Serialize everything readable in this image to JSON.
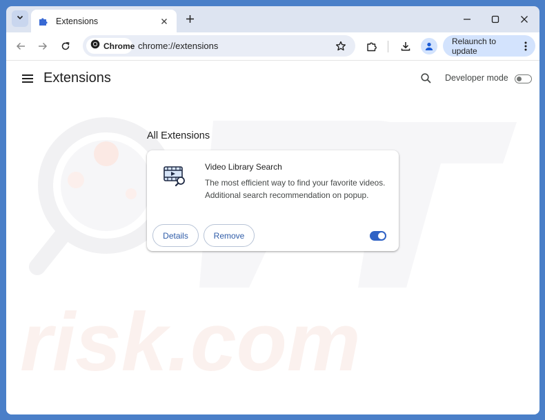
{
  "tabstrip": {
    "tab_title": "Extensions",
    "icons": [
      "tab-search-icon",
      "puzzle-icon",
      "close-icon",
      "plus-icon",
      "minimize-icon",
      "maximize-icon",
      "close-window-icon"
    ]
  },
  "toolbar": {
    "chip_label": "Chrome",
    "url": "chrome://extensions",
    "relaunch_label": "Relaunch to update",
    "icons": [
      "back-arrow-icon",
      "forward-arrow-icon",
      "reload-icon",
      "chrome-logo-icon",
      "star-icon",
      "extensions-puzzle-icon",
      "download-icon",
      "profile-icon",
      "more-vert-icon"
    ]
  },
  "header": {
    "title": "Extensions",
    "developer_mode_label": "Developer mode",
    "developer_mode_on": false
  },
  "main": {
    "section_title": "All Extensions",
    "extensions": [
      {
        "name": "Video Library Search",
        "description": "The most efficient way to find your favorite videos. Additional search recommendation on popup.",
        "details_label": "Details",
        "remove_label": "Remove",
        "enabled": true,
        "icon": "video-library-search-icon"
      }
    ]
  },
  "colors": {
    "frame": "#dde4f1",
    "accent": "#2f62c5",
    "button_text": "#2f5ca8",
    "relaunch_bg": "#d3e3fd"
  }
}
